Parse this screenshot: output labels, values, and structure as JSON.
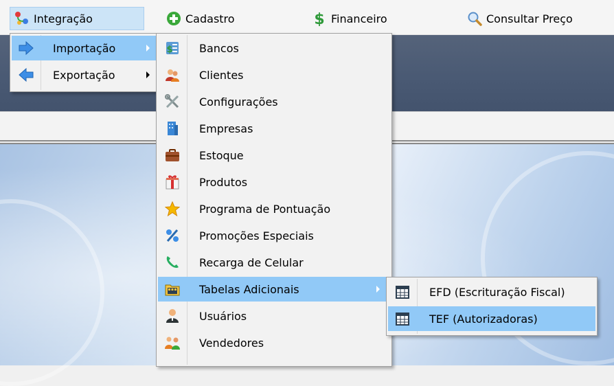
{
  "menubar": {
    "items": [
      {
        "label": "Integração",
        "icon": "integration-icon"
      },
      {
        "label": "Cadastro",
        "icon": "plus-circle-icon"
      },
      {
        "label": "Financeiro",
        "icon": "dollar-icon"
      },
      {
        "label": "Consultar Preço",
        "icon": "magnifier-icon"
      }
    ]
  },
  "integracao_menu": {
    "items": [
      {
        "label": "Importação",
        "icon": "arrow-right-icon"
      },
      {
        "label": "Exportação",
        "icon": "arrow-left-icon"
      }
    ]
  },
  "importacao_menu": {
    "items": [
      {
        "label": "Bancos",
        "icon": "bank-icon"
      },
      {
        "label": "Clientes",
        "icon": "clients-icon"
      },
      {
        "label": "Configurações",
        "icon": "tools-icon"
      },
      {
        "label": "Empresas",
        "icon": "building-icon"
      },
      {
        "label": "Estoque",
        "icon": "briefcase-icon"
      },
      {
        "label": "Produtos",
        "icon": "gift-icon"
      },
      {
        "label": "Programa de Pontuação",
        "icon": "star-icon"
      },
      {
        "label": "Promoções Especiais",
        "icon": "percent-icon"
      },
      {
        "label": "Recarga de Celular",
        "icon": "phone-icon"
      },
      {
        "label": "Tabelas Adicionais",
        "icon": "table-folder-icon"
      },
      {
        "label": "Usuários",
        "icon": "user-icon"
      },
      {
        "label": "Vendedores",
        "icon": "sellers-icon"
      }
    ]
  },
  "tabelas_menu": {
    "items": [
      {
        "label": "EFD (Escrituração Fiscal)",
        "icon": "calendar-table-icon"
      },
      {
        "label": "TEF (Autorizadoras)",
        "icon": "calendar-table-icon"
      }
    ]
  },
  "colors": {
    "highlight": "#91c9f7",
    "menubar_active": "#cce4f7",
    "header_band": "#4a5a74"
  }
}
